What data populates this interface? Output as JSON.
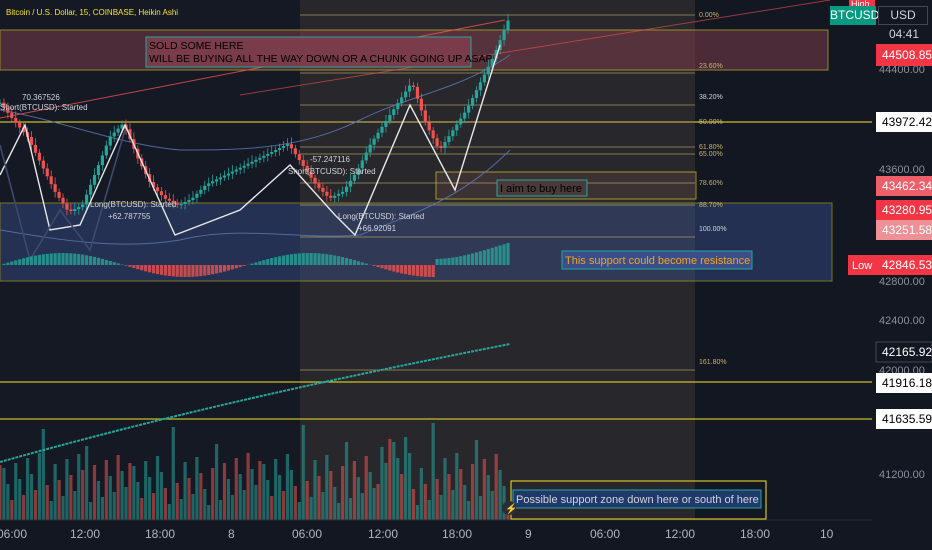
{
  "header": {
    "title": "Bitcoin / U.S. Dollar, 15, COINBASE, Heikin Ashi",
    "symbol": "BTCUSD",
    "currency": "USD",
    "countdown": "04:41"
  },
  "price_tags": {
    "high_label": "High",
    "high": "44508.85",
    "fib50": "43972.42",
    "tag1": "43462.34",
    "tag2": "43280.95",
    "tag3": "43251.58",
    "low_label": "Low",
    "low": "42846.53",
    "last": "42165.92",
    "sup1": "41916.18",
    "sup2": "41635.59"
  },
  "axis": {
    "y_ticks": [
      "44400.00",
      "43600.00",
      "42800.00",
      "42400.00",
      "42000.00",
      "41200.00"
    ],
    "x_ticks": [
      "06:00",
      "12:00",
      "18:00",
      "8",
      "06:00",
      "12:00",
      "18:00",
      "9",
      "06:00",
      "12:00",
      "18:00",
      "10"
    ]
  },
  "fib": {
    "levels": [
      "0.00%",
      "23.60%",
      "38.20%",
      "50.00%",
      "61.80%",
      "65.00%",
      "78.60%",
      "88.70%",
      "100.00%",
      "161.80%"
    ]
  },
  "notes": {
    "sold_line1": "SOLD SOME HERE",
    "sold_line2": "WILL BE BUYING ALL THE WAY DOWN OR A CHUNK GOING UP ASAP",
    "aim": "I aim to buy here",
    "support_resistance": "This support could become resistance",
    "support_zone": "Possible support zone down here or south of here"
  },
  "signals": {
    "price1": "70.367526",
    "short1": "Short(BTCUSD): Started",
    "long1": "Long(BTCUSD): Started",
    "price2": "+62.787755",
    "price3": "-57.247116",
    "short2": "Short(BTCUSD): Started",
    "long2": "Long(BTCUSD): Started",
    "price4": "+66.92091"
  },
  "colors": {
    "bg": "#131722",
    "up": "#26a69a",
    "down": "#ef5350",
    "highlight_yellow": "#f7e425",
    "text": "#d1d4dc"
  },
  "chart_data": {
    "type": "candlestick",
    "title": "Bitcoin / U.S. Dollar, 15, COINBASE, Heikin Ashi",
    "xlabel": "",
    "ylabel": "",
    "ylim": [
      40900,
      44700
    ],
    "x_ticks": [
      "06:00",
      "12:00",
      "18:00",
      "8",
      "06:00",
      "12:00",
      "18:00",
      "9",
      "06:00",
      "12:00",
      "18:00",
      "10"
    ],
    "horizontal_levels": [
      44508.85,
      43972.42,
      43462.34,
      43280.95,
      43251.58,
      42846.53,
      42165.92,
      41916.18,
      41635.59
    ],
    "close_path": [
      43950,
      43820,
      43700,
      43500,
      43300,
      43150,
      43200,
      43450,
      43700,
      43800,
      43550,
      43350,
      43250,
      43200,
      43250,
      43350,
      43400,
      43450,
      43500,
      43550,
      43600,
      43650,
      43500,
      43350,
      43250,
      43300,
      43450,
      43650,
      43800,
      43950,
      44100,
      43800,
      43600,
      43750,
      43900,
      44100,
      44300,
      44550
    ]
  }
}
